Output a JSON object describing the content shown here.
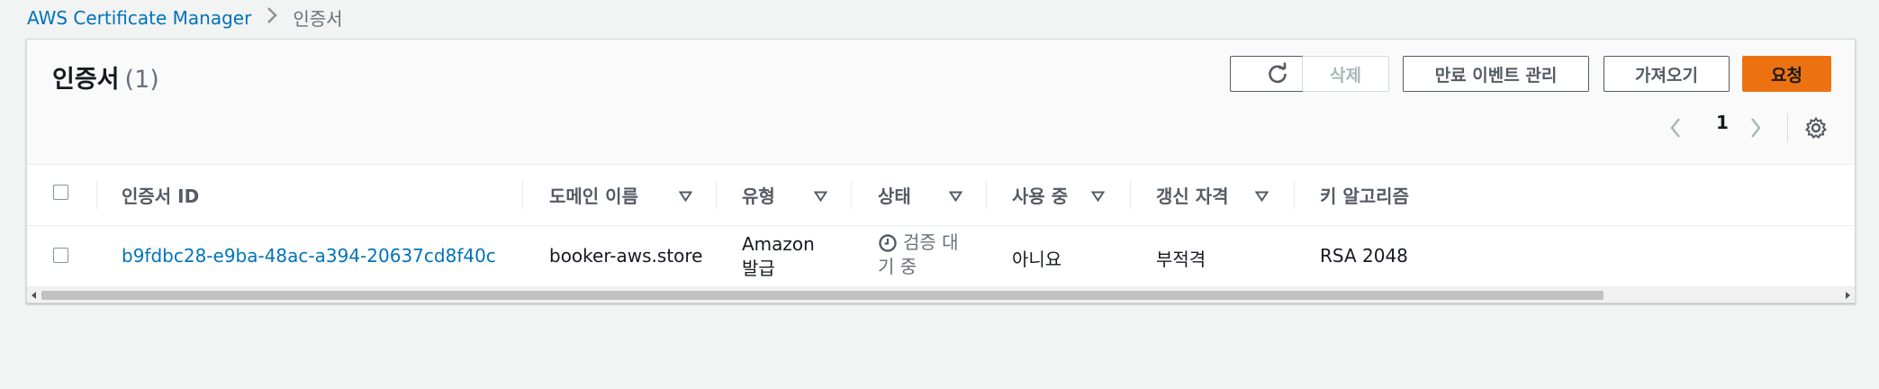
{
  "breadcrumb": {
    "parent": "AWS Certificate Manager",
    "current": "인증서"
  },
  "panel": {
    "title": "인증서",
    "count": "(1)"
  },
  "toolbar": {
    "refresh_icon": "refresh-icon",
    "delete_label": "삭제",
    "manage_events_label": "만료 이벤트 관리",
    "import_label": "가져오기",
    "request_label": "요청"
  },
  "pagination": {
    "page": "1"
  },
  "columns": {
    "cert_id": "인증서 ID",
    "domain": "도메인 이름",
    "type": "유형",
    "status": "상태",
    "in_use": "사용 중",
    "renewal": "갱신 자격",
    "key_algo": "키 알고리즘"
  },
  "rows": [
    {
      "cert_id": "b9fdbc28-e9ba-48ac-a394-20637cd8f40c",
      "domain": "booker-aws.store",
      "type_line1": "Amazon",
      "type_line2": "발급",
      "status_line1": "검증 대",
      "status_line2": "기 중",
      "in_use": "아니요",
      "renewal": "부적격",
      "key_algo": "RSA 2048"
    }
  ],
  "colors": {
    "link": "#0073bb",
    "primary": "#ec7211"
  }
}
